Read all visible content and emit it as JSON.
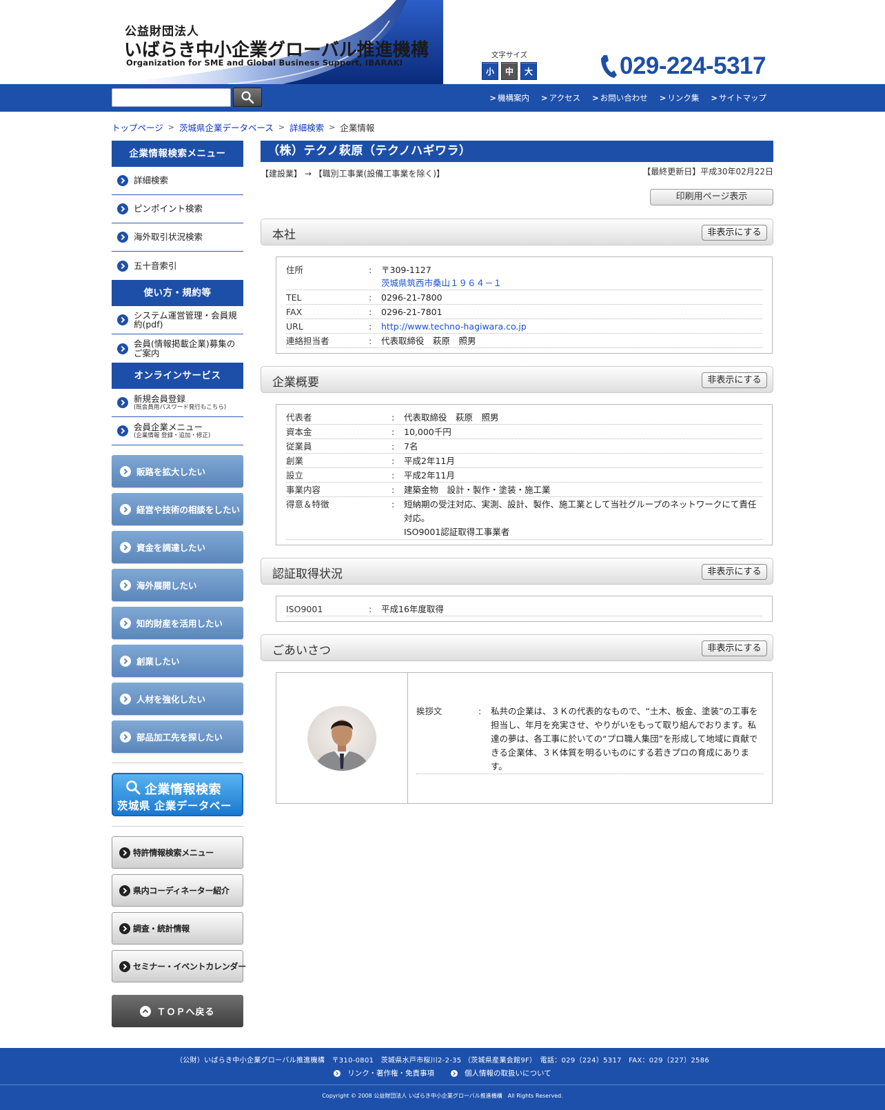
{
  "header": {
    "org_type": "公益財団法人",
    "org_name": "いばらき中小企業グローバル推進機構",
    "org_name_en": "Organization for SME and Global Business Support, IBARAKI",
    "font_size_label": "文字サイズ",
    "font_sizes": [
      "小",
      "中",
      "大"
    ],
    "phone": "029-224-5317"
  },
  "navbar": {
    "search_placeholder": "",
    "links": [
      "機構案内",
      "アクセス",
      "お問い合わせ",
      "リンク集",
      "サイトマップ"
    ]
  },
  "breadcrumb": {
    "items": [
      "トップページ",
      "茨城県企業データベース",
      "詳細検索"
    ],
    "current": "企業情報"
  },
  "sidebar": {
    "search_menu_title": "企業情報検索メニュー",
    "search_menu": [
      "詳細検索",
      "ピンポイント検索",
      "海外取引状況検索",
      "五十音索引"
    ],
    "usage_title": "使い方・規約等",
    "usage": [
      "システム運営管理・会員規約(pdf)",
      "会員(情報掲載企業)募集のご案内"
    ],
    "online_title": "オンラインサービス",
    "online": [
      {
        "label": "新規会員登録",
        "sub": "(既会員用パスワード発行もこちら)"
      },
      {
        "label": "会員企業メニュー",
        "sub": "(企業情報 登録・追加・修正)"
      }
    ],
    "purpose_buttons": [
      "販路を拡大したい",
      "経営や技術の相談をしたい",
      "資金を調達したい",
      "海外展開したい",
      "知的財産を活用したい",
      "創業したい",
      "人材を強化したい",
      "部品加工先を探したい"
    ],
    "db_banner_title": "企業情報検索",
    "db_banner_sub": "茨城県 企業データベース",
    "gray_buttons": [
      "特許情報検索メニュー",
      "県内コーディネーター紹介",
      "調査・統計情報",
      "セミナー・イベントカレンダー"
    ],
    "top_button": "ＴＯＰへ戻る"
  },
  "company": {
    "title": "（株）テクノ萩原（テクノハギワラ）",
    "industry": "【建設業】 → 【職別工事業(設備工事業を除く)】",
    "updated": "【最終更新日】平成30年02月22日",
    "print_label": "印刷用ページ表示",
    "hide_label": "非表示にする",
    "head_office": {
      "title": "本社",
      "address_label": "住所",
      "postal": "〒309-1127",
      "address": "茨城県筑西市桑山１９６４－１",
      "tel_label": "TEL",
      "tel": "0296-21-7800",
      "fax_label": "FAX",
      "fax": "0296-21-7801",
      "url_label": "URL",
      "url": "http://www.techno-hagiwara.co.jp",
      "contact_label": "連絡担当者",
      "contact": "代表取締役　萩原　照男"
    },
    "overview": {
      "title": "企業概要",
      "rows": [
        {
          "label": "代表者",
          "value": "代表取締役　萩原　照男"
        },
        {
          "label": "資本金",
          "value": "10,000千円"
        },
        {
          "label": "従業員",
          "value": "7名"
        },
        {
          "label": "創業",
          "value": "平成2年11月"
        },
        {
          "label": "設立",
          "value": "平成2年11月"
        },
        {
          "label": "事業内容",
          "value": "建築金物　設計・製作・塗装・施工業"
        }
      ],
      "features_label": "得意＆特徴",
      "features_1": "短納期の受注対応、実測、設計、製作、施工業として当社グループのネットワークにて責任対応。",
      "features_2": "ISO9001認証取得工事業者"
    },
    "certification": {
      "title": "認証取得状況",
      "label": "ISO9001",
      "value": "平成16年度取得"
    },
    "greeting": {
      "title": "ごあいさつ",
      "label": "挨拶文",
      "text": "私共の企業は、３Ｋの代表的なもので、“土木、板金、塗装”の工事を担当し、年月を充実させ、やりがいをもって取り組んでおります。私達の夢は、各工事に於いての“プロ職人集団”を形成して地域に貢献できる企業体、３Ｋ体質を明るいものにする若きプロの育成にあります。"
    }
  },
  "footer": {
    "address": "（公財）いばらき中小企業グローバル推進機構　〒310-0801　茨城県水戸市桜川2-2-35 （茨城県産業会館9F）　電話：029（224）5317　FAX：029（227）2586",
    "links": [
      "リンク・著作権・免責事項",
      "個人情報の取扱いについて"
    ],
    "copyright": "Copyright © 2008 公益財団法人 いばらき中小企業グローバル推進機構　All Rights Reserved."
  },
  "colors": {
    "brand_blue": "#1d50ab",
    "button_blue": "#5b86bb",
    "link_blue": "#1a4fcf"
  }
}
